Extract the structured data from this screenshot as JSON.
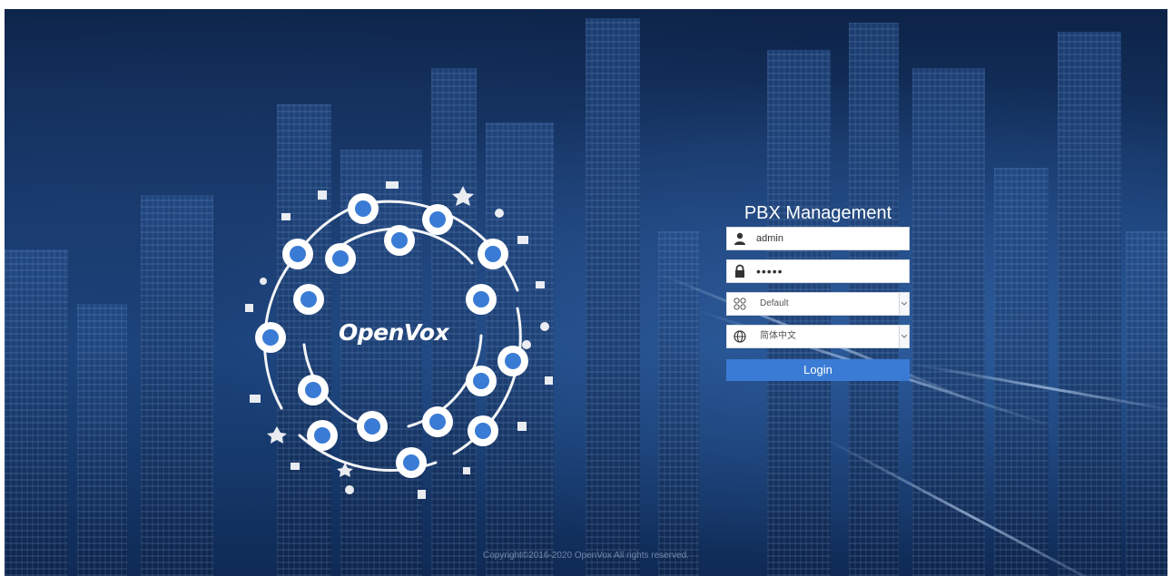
{
  "login": {
    "title": "PBX Management",
    "username": {
      "value": "admin",
      "icon": "user-icon"
    },
    "password": {
      "value": "•••••",
      "icon": "lock-icon"
    },
    "group_select": {
      "selected": "Default",
      "icon": "grid-icon"
    },
    "language_select": {
      "selected": "简体中文",
      "icon": "globe-icon"
    },
    "submit_label": "Login"
  },
  "brand": {
    "logo_text": "OpenVox"
  },
  "footer": {
    "copyright": "Copyright©2016-2020 OpenVox All rights reserved."
  },
  "colors": {
    "accent": "#3a7bd5",
    "background": "#173a6e",
    "panel_text": "#ffffff"
  }
}
